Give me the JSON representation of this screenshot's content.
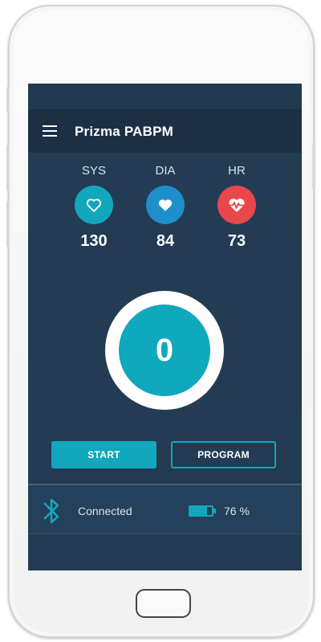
{
  "app": {
    "title": "Prizma PABPM"
  },
  "metrics": [
    {
      "label": "SYS",
      "value": "130",
      "icon": "heart-outline-icon",
      "color": "#13a7bd"
    },
    {
      "label": "DIA",
      "value": "84",
      "icon": "heart-filled-icon",
      "color": "#1e8fca"
    },
    {
      "label": "HR",
      "value": "73",
      "icon": "heart-pulse-icon",
      "color": "#e8474c"
    }
  ],
  "gauge": {
    "value": "0"
  },
  "buttons": {
    "start": "START",
    "program": "PROGRAM"
  },
  "status": {
    "connection": "Connected",
    "battery_text": "76 %",
    "battery_level": 0.76
  },
  "colors": {
    "accent": "#13a7bd",
    "background": "#233c53",
    "appbar": "#1d2f44",
    "alert": "#e8474c"
  }
}
